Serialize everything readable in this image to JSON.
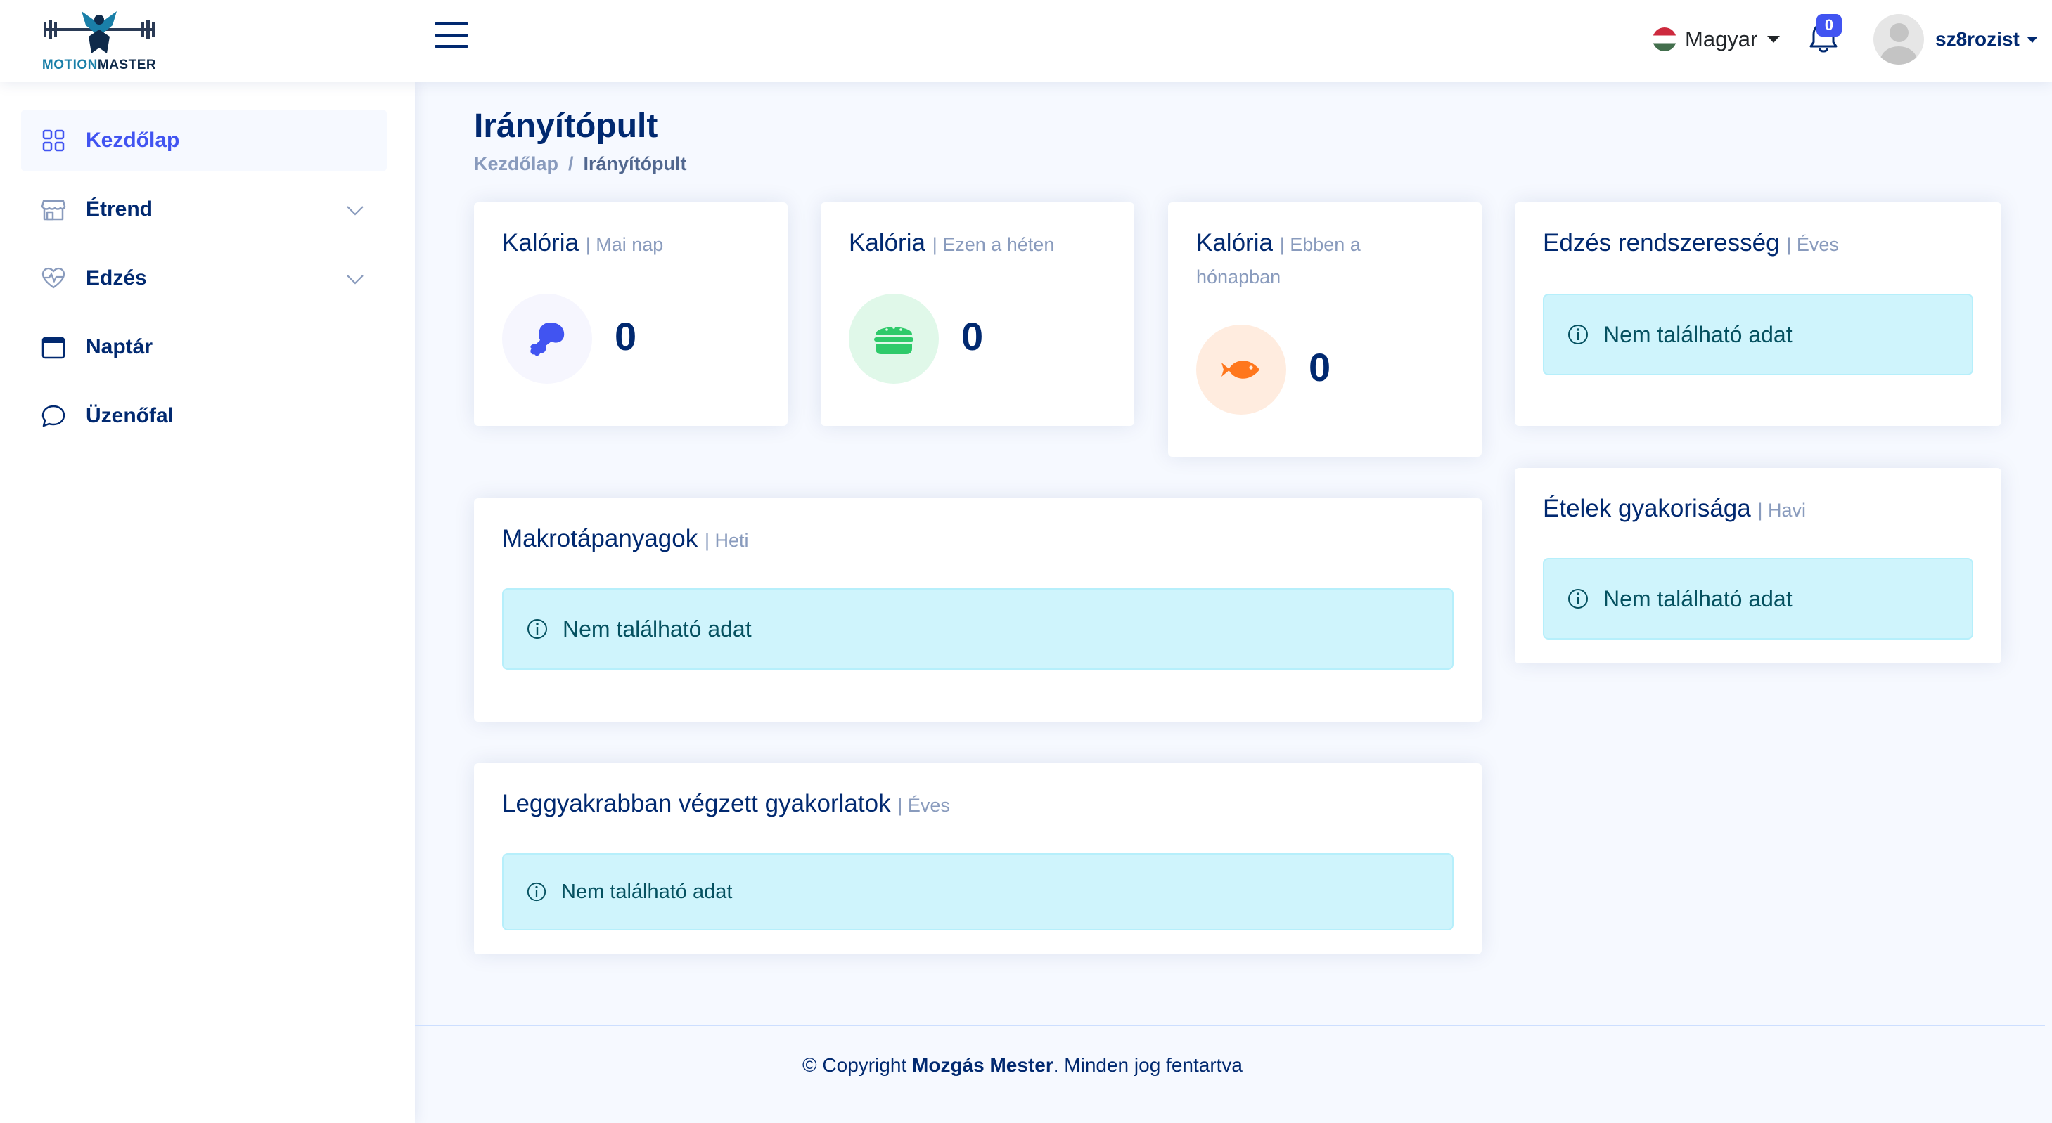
{
  "header": {
    "logo_text_a": "MOTION",
    "logo_text_b": "MASTER",
    "language": "Magyar",
    "notification_count": "0",
    "username": "sz8rozist"
  },
  "sidebar": {
    "items": [
      {
        "label": "Kezdőlap",
        "icon": "grid-icon",
        "active": true
      },
      {
        "label": "Étrend",
        "icon": "shop-icon",
        "has_submenu": true
      },
      {
        "label": "Edzés",
        "icon": "heart-pulse-icon",
        "has_submenu": true
      },
      {
        "label": "Naptár",
        "icon": "calendar-icon"
      },
      {
        "label": "Üzenőfal",
        "icon": "chat-icon"
      }
    ]
  },
  "page": {
    "title": "Irányítópult",
    "breadcrumb": [
      "Kezdőlap",
      "Irányítópult"
    ]
  },
  "cards": {
    "cal_today": {
      "title": "Kalória",
      "sub": "| Mai nap",
      "value": "0",
      "icon": "drumstick-icon",
      "icon_color": "#4154f1",
      "icon_bg": "#f6f6fe"
    },
    "cal_week": {
      "title": "Kalória",
      "sub": "| Ezen a héten",
      "value": "0",
      "icon": "burger-icon",
      "icon_color": "#2eca6a",
      "icon_bg": "#e0f8e9"
    },
    "cal_month": {
      "title": "Kalória",
      "sub": "| Ebben a hónapban",
      "value": "0",
      "icon": "fish-icon",
      "icon_color": "#ff771d",
      "icon_bg": "#ffecdf"
    },
    "training_regularity": {
      "title": "Edzés rendszeresség",
      "sub": "| Éves",
      "alert": "Nem található adat"
    },
    "macros": {
      "title": "Makrotápanyagok",
      "sub": "| Heti",
      "alert": "Nem található adat"
    },
    "food_frequency": {
      "title": "Ételek gyakorisága",
      "sub": "| Havi",
      "alert": "Nem található adat"
    },
    "frequent_exercises": {
      "title": "Leggyakrabban végzett gyakorlatok",
      "sub": "| Éves",
      "alert": "Nem található adat"
    }
  },
  "footer": {
    "prefix": "© Copyright ",
    "brand": "Mozgás Mester",
    "suffix": ". Minden jog fentartva"
  },
  "colors": {
    "primary": "#4154f1",
    "navy": "#012970",
    "muted": "#899bbd",
    "info_bg": "#cff4fc",
    "info_text": "#055160"
  }
}
